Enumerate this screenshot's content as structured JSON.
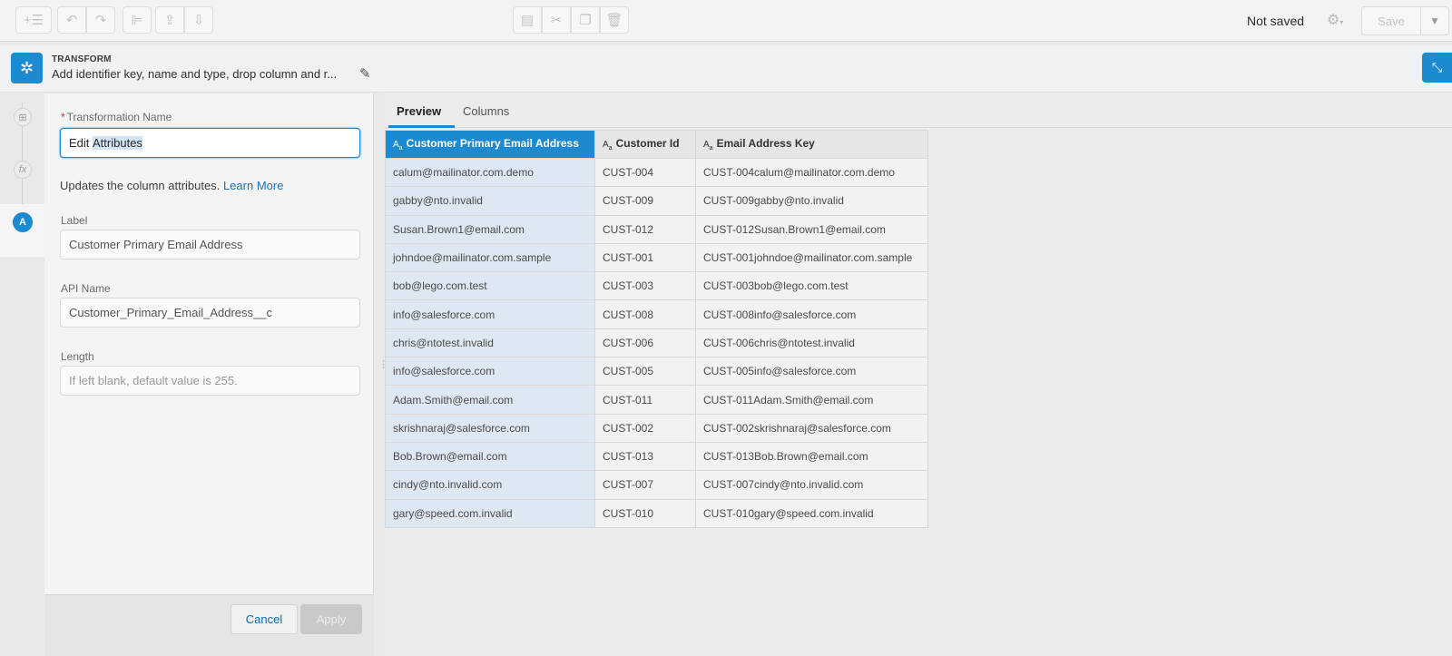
{
  "toolbar": {
    "status": "Not saved",
    "save_label": "Save",
    "icons": [
      "add-node-icon",
      "undo-icon",
      "redo-icon",
      "align-icon",
      "upload-icon",
      "download-icon",
      "clipboard-icon",
      "cut-icon",
      "copy-icon",
      "delete-icon",
      "gear-icon",
      "chevron-down-icon"
    ]
  },
  "transform": {
    "type_label": "TRANSFORM",
    "description": "Add identifier key, name and type, drop column and r..."
  },
  "form": {
    "name_label": "Transformation Name",
    "name_value_before": "Edit ",
    "name_value_selected": "Attributes",
    "help_text": "Updates the column attributes.",
    "learn_more": "Learn More",
    "label_label": "Label",
    "label_value": "Customer Primary Email Address",
    "api_label": "API Name",
    "api_value": "Customer_Primary_Email_Address__c",
    "length_label": "Length",
    "length_placeholder": "If left blank, default value is 255.",
    "cancel": "Cancel",
    "apply": "Apply"
  },
  "preview": {
    "tabs": [
      "Preview",
      "Columns"
    ],
    "columns": [
      "Customer Primary Email Address",
      "Customer Id",
      "Email Address Key"
    ],
    "rows": [
      [
        "calum@mailinator.com.demo",
        "CUST-004",
        "CUST-004calum@mailinator.com.demo"
      ],
      [
        "gabby@nto.invalid",
        "CUST-009",
        "CUST-009gabby@nto.invalid"
      ],
      [
        "Susan.Brown1@email.com",
        "CUST-012",
        "CUST-012Susan.Brown1@email.com"
      ],
      [
        "johndoe@mailinator.com.sample",
        "CUST-001",
        "CUST-001johndoe@mailinator.com.sample"
      ],
      [
        "bob@lego.com.test",
        "CUST-003",
        "CUST-003bob@lego.com.test"
      ],
      [
        "info@salesforce.com",
        "CUST-008",
        "CUST-008info@salesforce.com"
      ],
      [
        "chris@ntotest.invalid",
        "CUST-006",
        "CUST-006chris@ntotest.invalid"
      ],
      [
        "info@salesforce.com",
        "CUST-005",
        "CUST-005info@salesforce.com"
      ],
      [
        "Adam.Smith@email.com",
        "CUST-011",
        "CUST-011Adam.Smith@email.com"
      ],
      [
        "skrishnaraj@salesforce.com",
        "CUST-002",
        "CUST-002skrishnaraj@salesforce.com"
      ],
      [
        "Bob.Brown@email.com",
        "CUST-013",
        "CUST-013Bob.Brown@email.com"
      ],
      [
        "cindy@nto.invalid.com",
        "CUST-007",
        "CUST-007cindy@nto.invalid.com"
      ],
      [
        "gary@speed.com.invalid",
        "CUST-010",
        "CUST-010gary@speed.com.invalid"
      ]
    ]
  },
  "colors": {
    "accent": "#1b8ad1",
    "selected_column_bg": "#dde8f3"
  }
}
